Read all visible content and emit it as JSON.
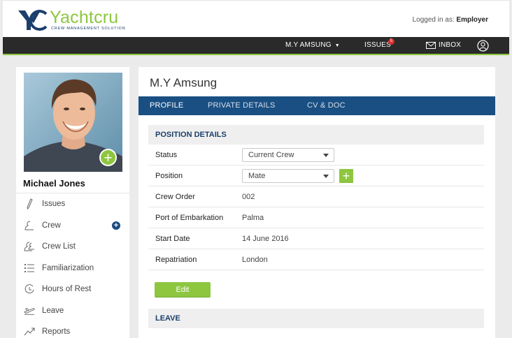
{
  "brand": {
    "name": "Yachtcru",
    "tagline": "CREW MANAGEMENT SOLUTION",
    "color": "#8dc63f",
    "navy": "#1b3f6b"
  },
  "header": {
    "logged_prefix": "Logged in as:",
    "logged_user": "Employer"
  },
  "nav": {
    "vessel": "M.Y AMSUNG",
    "issues": "ISSUES",
    "issues_badge": "5",
    "inbox": "INBOX",
    "user_icon": "user-circle-icon"
  },
  "profile": {
    "name": "Michael Jones"
  },
  "sidebar": {
    "items": [
      {
        "label": "Issues",
        "icon": "pen-icon"
      },
      {
        "label": "Crew",
        "icon": "crew-icon",
        "has_add": true
      },
      {
        "label": "Crew List",
        "icon": "crew-list-icon"
      },
      {
        "label": "Familiarization",
        "icon": "list-icon"
      },
      {
        "label": "Hours of Rest",
        "icon": "clock-icon"
      },
      {
        "label": "Leave",
        "icon": "plane-icon"
      },
      {
        "label": "Reports",
        "icon": "chart-line-icon"
      }
    ]
  },
  "main": {
    "title": "M.Y Amsung",
    "tabs": [
      {
        "label": "PROFILE",
        "active": true
      },
      {
        "label": "PRIVATE DETAILS",
        "active": false
      },
      {
        "label": "CV & DOC",
        "active": false
      }
    ],
    "position_section": "POSITION DETAILS",
    "fields": [
      {
        "label": "Status",
        "value": "Current Crew",
        "type": "select"
      },
      {
        "label": "Position",
        "value": "Mate",
        "type": "select"
      },
      {
        "label": "Crew Order",
        "value": "002",
        "type": "text"
      },
      {
        "label": "Port of Embarkation",
        "value": "Palma",
        "type": "text"
      },
      {
        "label": "Start Date",
        "value": "14 June 2016",
        "type": "text"
      },
      {
        "label": "Repatriation",
        "value": "London",
        "type": "text"
      }
    ],
    "edit_label": "Edit",
    "leave_section": "LEAVE"
  }
}
